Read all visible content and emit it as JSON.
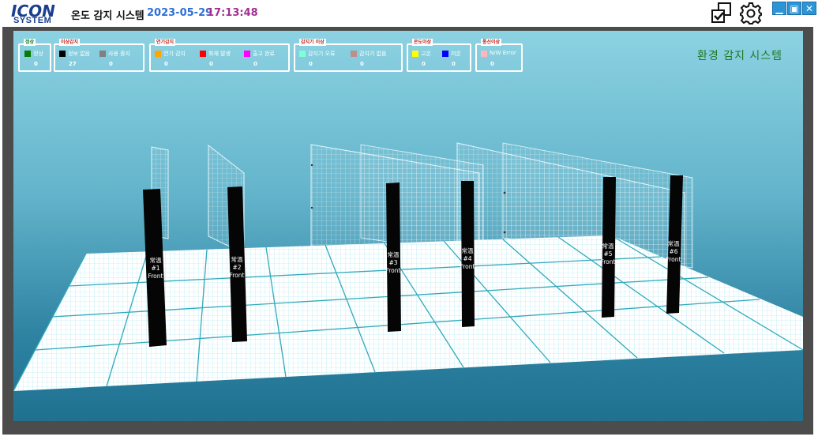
{
  "app": {
    "logo_line1": "ICON",
    "logo_line2": "SYSTEM",
    "title": "온도 감지 시스템",
    "date": "2023-05-29",
    "time": "17:13:48"
  },
  "toolbar": {
    "select_icon": "checkbox-pages-icon",
    "settings_icon": "gear-icon",
    "minimize_label": "▁",
    "maximize_label": "▣",
    "close_label": "✕"
  },
  "status_groups": [
    {
      "title": "정상",
      "items": [
        {
          "label": "정상",
          "color": "#0a7a0a",
          "count": "0"
        }
      ]
    },
    {
      "title": "이상감지",
      "items": [
        {
          "label": "정보 없음",
          "color": "#000000",
          "count": "27"
        },
        {
          "label": "사용 중지",
          "color": "#808080",
          "count": "0"
        }
      ]
    },
    {
      "title": "연기감지",
      "items": [
        {
          "label": "연기 감지",
          "color": "#ffa500",
          "count": "0"
        },
        {
          "label": "화재 발생",
          "color": "#ff0000",
          "count": "0"
        },
        {
          "label": "출고 완료",
          "color": "#ff00ff",
          "count": "0"
        }
      ]
    },
    {
      "title": "감지기 이상",
      "items": [
        {
          "label": "감지기 오류",
          "color": "#7fffd4",
          "count": "0"
        },
        {
          "label": "감지기 없음",
          "color": "#bc8f8f",
          "count": "0"
        }
      ]
    },
    {
      "title": "온도이상",
      "items": [
        {
          "label": "고온",
          "color": "#ffff00",
          "count": "0"
        },
        {
          "label": "저온",
          "color": "#0000ff",
          "count": "0"
        }
      ]
    },
    {
      "title": "통신이상",
      "items": [
        {
          "label": "N/W Error",
          "color": "#ffb6c1",
          "count": "0"
        }
      ]
    }
  ],
  "scene": {
    "system_title": "환경 감지 시스템",
    "pillars": [
      {
        "line1": "常溫",
        "line2": "#1",
        "line3": "Front"
      },
      {
        "line1": "常溫",
        "line2": "#2",
        "line3": "Front"
      },
      {
        "line1": "常溫",
        "line2": "#3",
        "line3": "Front"
      },
      {
        "line1": "常溫",
        "line2": "#4",
        "line3": "Front"
      },
      {
        "line1": "常溫",
        "line2": "#5",
        "line3": "Front"
      },
      {
        "line1": "常溫",
        "line2": "#6",
        "line3": "Front"
      }
    ]
  }
}
